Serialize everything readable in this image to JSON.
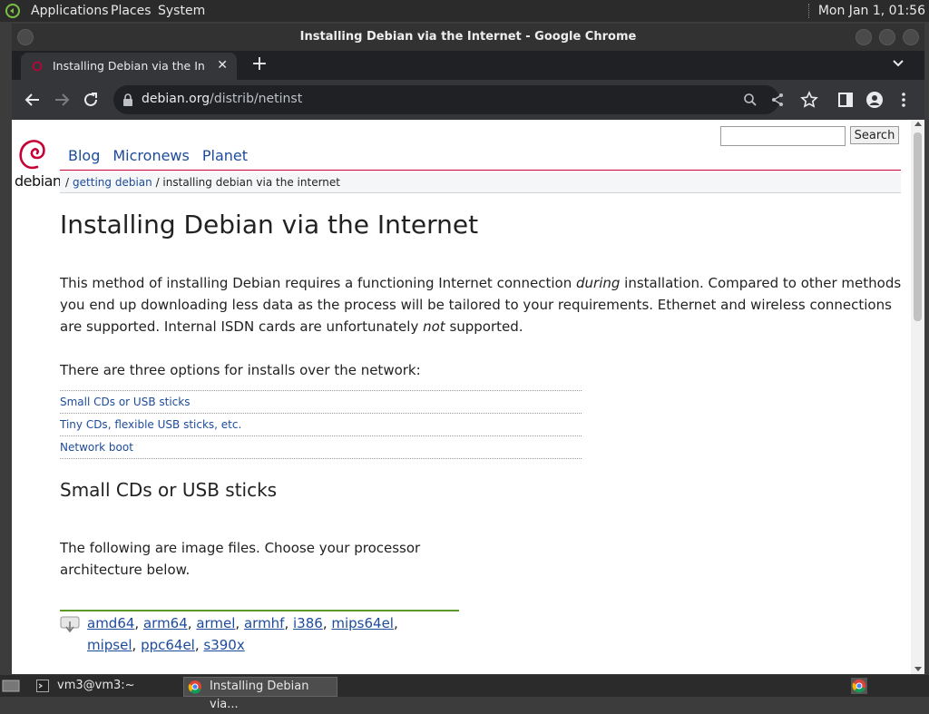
{
  "top_panel": {
    "menus": [
      "Applications",
      "Places",
      "System"
    ],
    "clock": "Mon Jan 1, 01:56"
  },
  "window": {
    "title": "Installing Debian via the Internet - Google Chrome"
  },
  "tab": {
    "title": "Installing Debian via the Intern",
    "close": "✕",
    "new_tab": "+"
  },
  "omnibox": {
    "host": "debian.org",
    "path": "/distrib/netinst"
  },
  "page": {
    "search_button": "Search",
    "search_value": "",
    "logo_text": "debian",
    "nav": [
      "Blog",
      "Micronews",
      "Planet"
    ],
    "breadcrumb": {
      "sep": "/",
      "link": "getting debian",
      "current": " / installing debian via the internet"
    },
    "title": "Installing Debian via the Internet",
    "intro": {
      "part1": "This method of installing Debian requires a functioning Internet connection ",
      "em1": "during",
      "part2": " installation. Compared to other methods you end up downloading less data as the process will be tailored to your requirements. Ethernet and wireless connections are supported. Internal ISDN cards are unfortunately ",
      "em2": "not",
      "part3": " supported."
    },
    "options_intro": "There are three options for installs over the network:",
    "toc": [
      "Small CDs or USB sticks",
      "Tiny CDs, flexible USB sticks, etc.",
      "Network boot"
    ],
    "section_title": "Small CDs or USB sticks",
    "section_text": "The following are image files. Choose your processor architecture below.",
    "architectures": [
      "amd64",
      "arm64",
      "armel",
      "armhf",
      "i386",
      "mips64el",
      "mipsel",
      "ppc64el",
      "s390x"
    ]
  },
  "taskbar": {
    "terminal": "vm3@vm3:~",
    "chrome": "Installing Debian via..."
  },
  "colors": {
    "debian_red": "#c70036",
    "link_blue": "#1d4b9b",
    "download_green": "#5b9a2a"
  },
  "icons": [
    "back-arrow-icon",
    "forward-arrow-icon",
    "reload-icon",
    "lock-icon",
    "zoom-icon",
    "share-icon",
    "bookmark-star-icon",
    "side-panel-icon",
    "profile-icon",
    "kebab-menu-icon",
    "debian-swirl-logo",
    "download-icon"
  ]
}
